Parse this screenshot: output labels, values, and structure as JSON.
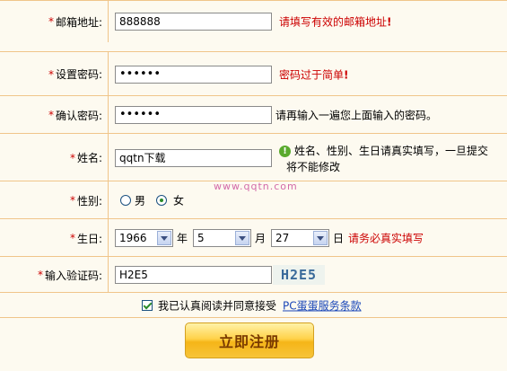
{
  "form": {
    "star": "*",
    "email": {
      "label": "邮箱地址:",
      "value": "888888",
      "hint": "请填写有效的邮箱地址",
      "bang": "!"
    },
    "password": {
      "label": "设置密码:",
      "value": "••••••",
      "hint": "密码过于简单",
      "bang": "!"
    },
    "confirm": {
      "label": "确认密码:",
      "value": "••••••",
      "hint": "请再输入一遍您上面输入的密码。"
    },
    "name": {
      "label": "姓名:",
      "value": "qqtn下载",
      "hint_line1": "姓名、性别、生日请真实填写，一旦提交",
      "hint_line2": "将不能修改",
      "info_icon": "info-icon"
    },
    "gender": {
      "label": "性别:",
      "options": [
        "男",
        "女"
      ],
      "selected": "女"
    },
    "birthday": {
      "label": "生日:",
      "year": "1966",
      "year_unit": "年",
      "month": "5",
      "month_unit": "月",
      "day": "27",
      "day_unit": "日",
      "hint": "请务必真实填写"
    },
    "captcha": {
      "label": "输入验证码:",
      "value": "H2E5",
      "image_text": "H2E5"
    },
    "agree": {
      "text": "我已认真阅读并同意接受",
      "link": "PC蛋蛋服务条款"
    },
    "submit_label": "立即注册"
  },
  "watermark": "www.qqtn.com",
  "colors": {
    "border": "#f0c58a",
    "background": "#fdfaf0",
    "error": "#cc0000",
    "link": "#1a47b8"
  }
}
